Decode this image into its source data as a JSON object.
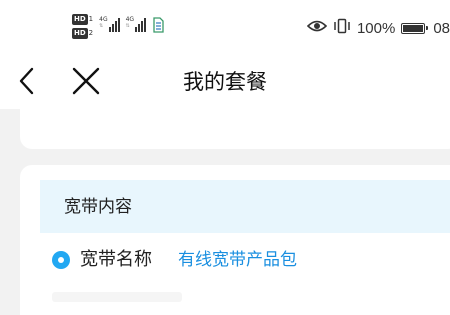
{
  "status_bar": {
    "sim1_badge": "HD",
    "sim1_num": "1",
    "sim2_badge": "HD",
    "sim2_num": "2",
    "network1": "4G",
    "network2": "4G",
    "battery_percent": "100%",
    "battery_level": 1.0,
    "time_partial": "08",
    "icons": [
      "eye-icon",
      "vibrate-icon",
      "battery-icon",
      "signal-icon",
      "sim-card-icon"
    ]
  },
  "nav": {
    "title": "我的套餐",
    "back_icon": "chevron-left-icon",
    "close_icon": "close-icon"
  },
  "section": {
    "title": "宽带内容",
    "fields": [
      {
        "label": "宽带名称",
        "value": "有线宽带产品包"
      }
    ]
  },
  "colors": {
    "accent": "#22a8f2",
    "link": "#1a8fe0",
    "section_header_bg": "#e8f6fd",
    "page_bg": "#f2f2f2"
  }
}
